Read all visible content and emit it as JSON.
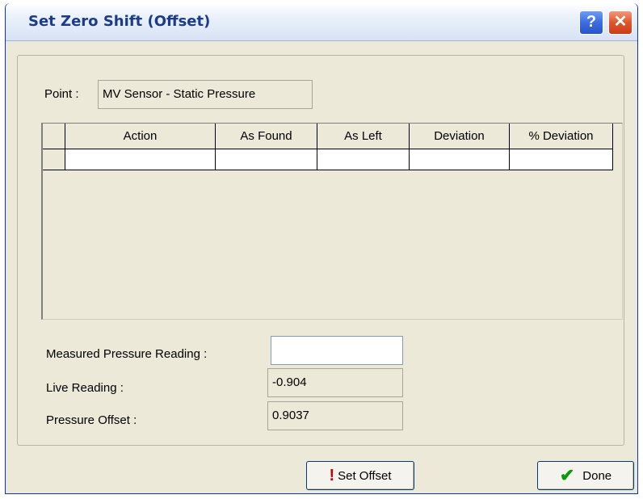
{
  "window": {
    "title": "Set Zero Shift (Offset)"
  },
  "titlebar_buttons": {
    "help": "?",
    "close": "✕"
  },
  "point": {
    "label": "Point :",
    "value": "MV Sensor - Static Pressure"
  },
  "table": {
    "columns": [
      "Action",
      "As Found",
      "As Left",
      "Deviation",
      "% Deviation"
    ],
    "rows": [
      [
        "",
        "",
        "",
        "",
        ""
      ]
    ]
  },
  "readings": {
    "measured": {
      "label": "Measured Pressure Reading :",
      "value": ""
    },
    "live": {
      "label": "Live Reading :",
      "value": "-0.904"
    },
    "offset": {
      "label": "Pressure Offset :",
      "value": "0.9037"
    }
  },
  "buttons": {
    "set_offset": "Set Offset",
    "done": "Done"
  },
  "icons": {
    "set_offset": "exclamation-icon",
    "done": "checkmark-icon"
  }
}
